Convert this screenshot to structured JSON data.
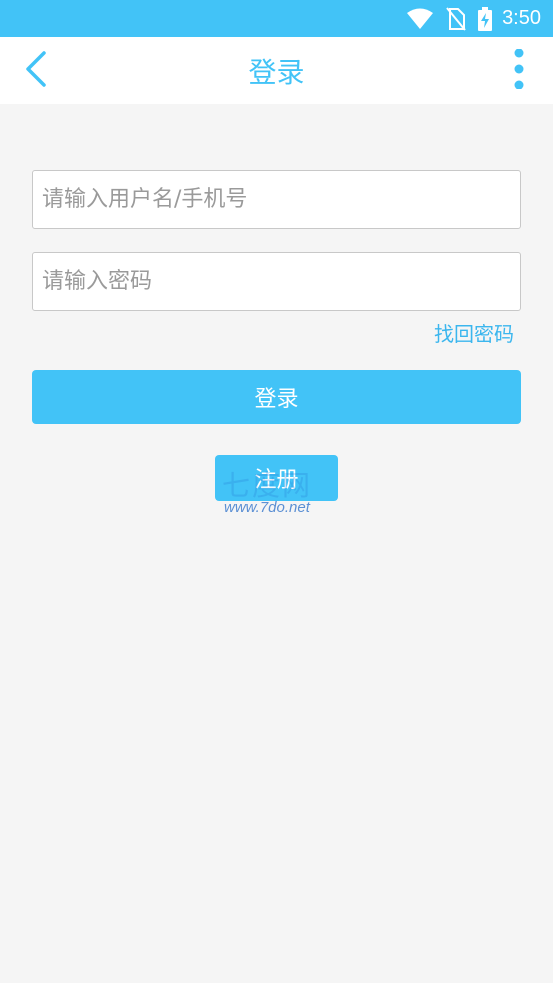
{
  "status_bar": {
    "time": "3:50",
    "icons": [
      "wifi-icon",
      "no-sim-icon",
      "battery-charging-icon"
    ]
  },
  "app_bar": {
    "title": "登录",
    "back_icon": "chevron-left-icon",
    "more_icon": "more-vertical-icon"
  },
  "form": {
    "username_placeholder": "请输入用户名/手机号",
    "username_value": "",
    "password_placeholder": "请输入密码",
    "password_value": "",
    "forgot_password": "找回密码",
    "login_button": "登录",
    "register_button": "注册"
  },
  "watermark": {
    "text": "七度网",
    "url": "www.7do.net"
  },
  "colors": {
    "accent": "#42c3f7",
    "background": "#f5f5f5",
    "input_border": "#c8c8c8",
    "placeholder": "#9a9a9a"
  }
}
